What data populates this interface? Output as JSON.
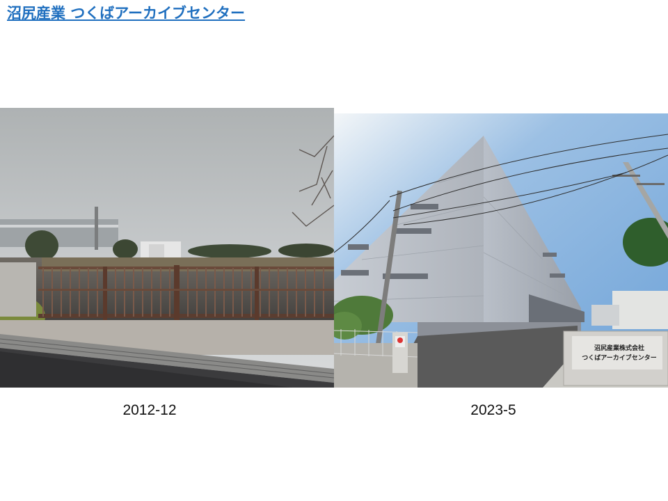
{
  "title": {
    "text": "沼尻産業 つくばアーカイブセンター",
    "link_color": "#1f6fbf"
  },
  "photos": [
    {
      "caption": "2012-12",
      "subject": "empty-lot-with-gate"
    },
    {
      "caption": "2023-5",
      "subject": "warehouse-building",
      "sign": {
        "line1": "沼尻産業株式会社",
        "line2": "つくばアーカイブセンター"
      }
    }
  ]
}
